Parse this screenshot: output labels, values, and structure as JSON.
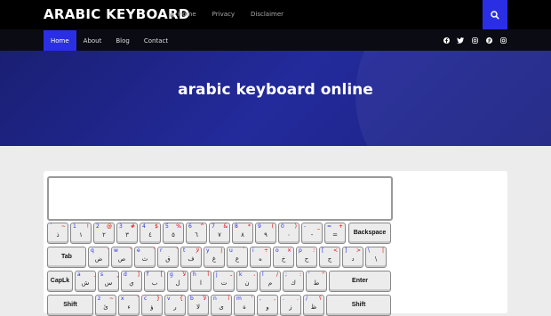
{
  "header": {
    "brand": "ARABIC KEYBOARD",
    "links": [
      "Home",
      "Privacy",
      "Disclaimer"
    ],
    "search_icon": "search-icon"
  },
  "nav": {
    "items": [
      "Home",
      "About",
      "Blog",
      "Contact"
    ],
    "active": "Home"
  },
  "social": [
    "facebook-icon",
    "twitter-icon",
    "instagram-icon",
    "pinterest-icon",
    "instagram-icon"
  ],
  "hero": {
    "title": "arabic keyboard online"
  },
  "colors": {
    "accent": "#2a2fe6",
    "hero": "#1f2588",
    "black": "#000000"
  },
  "keyboard": {
    "row1": [
      {
        "s": "`",
        "a": "~",
        "m": "ذ"
      },
      {
        "s": "1",
        "a": "!",
        "m": "١"
      },
      {
        "s": "2",
        "a": "@",
        "m": "٢"
      },
      {
        "s": "3",
        "a": "#",
        "m": "٣"
      },
      {
        "s": "4",
        "a": "$",
        "m": "٤"
      },
      {
        "s": "5",
        "a": "%",
        "m": "٥"
      },
      {
        "s": "6",
        "a": "^",
        "m": "٦"
      },
      {
        "s": "7",
        "a": "&",
        "m": "٧"
      },
      {
        "s": "8",
        "a": "*",
        "m": "٨"
      },
      {
        "s": "9",
        "a": "(",
        "m": "٩"
      },
      {
        "s": "0",
        "a": ")",
        "m": "٠"
      },
      {
        "s": "-",
        "a": "_",
        "m": "-"
      },
      {
        "s": "=",
        "a": "+",
        "m": "="
      }
    ],
    "backspace": "Backspace",
    "tab": "Tab",
    "row2": [
      {
        "s": "q",
        "a": "َ",
        "m": "ض"
      },
      {
        "s": "w",
        "a": "ً",
        "m": "ص"
      },
      {
        "s": "e",
        "a": "ُ",
        "m": "ث"
      },
      {
        "s": "r",
        "a": "ٌ",
        "m": "ق"
      },
      {
        "s": "t",
        "a": "لإ",
        "m": "ف"
      },
      {
        "s": "y",
        "a": "إ",
        "m": "غ"
      },
      {
        "s": "u",
        "a": "`",
        "m": "ع"
      },
      {
        "s": "i",
        "a": "÷",
        "m": "ه"
      },
      {
        "s": "o",
        "a": "×",
        "m": "خ"
      },
      {
        "s": "p",
        "a": "؛",
        "m": "ح"
      },
      {
        "s": "[",
        "a": "<",
        "m": "ج"
      },
      {
        "s": "]",
        "a": ">",
        "m": "د"
      },
      {
        "s": "\\",
        "a": "|",
        "m": "\\"
      }
    ],
    "caps": "CapLk",
    "row3": [
      {
        "s": "a",
        "a": "ِ",
        "m": "ش"
      },
      {
        "s": "s",
        "a": "ٍ",
        "m": "س"
      },
      {
        "s": "d",
        "a": "]",
        "m": "ي"
      },
      {
        "s": "f",
        "a": "[",
        "m": "ب"
      },
      {
        "s": "g",
        "a": "لأ",
        "m": "ل"
      },
      {
        "s": "h",
        "a": "أ",
        "m": "ا"
      },
      {
        "s": "j",
        "a": "ـ",
        "m": "ت"
      },
      {
        "s": "k",
        "a": "،",
        "m": "ن"
      },
      {
        "s": "l",
        "a": "/",
        "m": "م"
      },
      {
        "s": ";",
        "a": ":",
        "m": "ك"
      },
      {
        "s": "'",
        "a": "\"",
        "m": "ط"
      }
    ],
    "enter": "Enter",
    "shift": "Shift",
    "row4": [
      {
        "s": "z",
        "a": "~",
        "m": "ئ"
      },
      {
        "s": "x",
        "a": "ْ",
        "m": "ء"
      },
      {
        "s": "c",
        "a": "}",
        "m": "ؤ"
      },
      {
        "s": "v",
        "a": "{",
        "m": "ر"
      },
      {
        "s": "b",
        "a": "لآ",
        "m": "لا"
      },
      {
        "s": "n",
        "a": "آ",
        "m": "ى"
      },
      {
        "s": "m",
        "a": "'",
        "m": "ة"
      },
      {
        "s": ",",
        "a": ",",
        "m": "و"
      },
      {
        "s": ".",
        "a": ".",
        "m": "ز"
      },
      {
        "s": "/",
        "a": "؟",
        "m": "ظ"
      }
    ]
  }
}
